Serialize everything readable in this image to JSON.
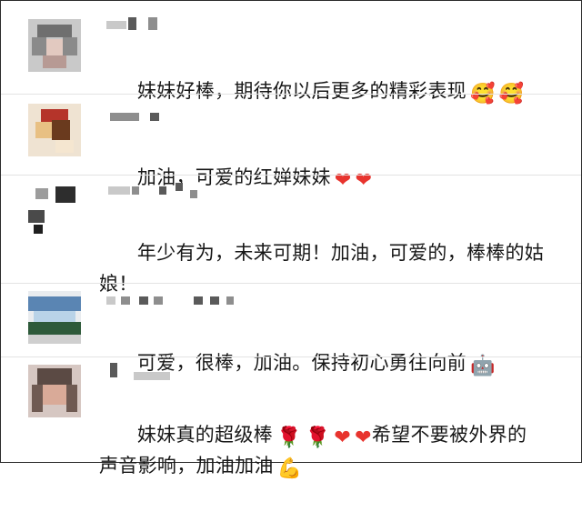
{
  "comments": [
    {
      "name": "",
      "text": "妹妹好棒，期待你以后更多的精彩表现",
      "emojis": [
        "🥰",
        "🥰"
      ],
      "emoji_icons": [
        "blush-face-icon",
        "blush-face-icon"
      ]
    },
    {
      "name": "",
      "text": "加油，可爱的红婵妹妹",
      "emojis": [
        "❤",
        "❤"
      ],
      "emoji_icons": [
        "red-heart-icon",
        "red-heart-icon"
      ]
    },
    {
      "name": "",
      "text": "年少有为，未来可期！加油，可爱的，棒棒的姑\n娘！",
      "emojis": [],
      "emoji_icons": []
    },
    {
      "name": "",
      "text": "可爱，很棒，加油。保持初心勇往向前",
      "emojis": [
        "🤖"
      ],
      "emoji_icons": [
        "robot-face-icon"
      ]
    },
    {
      "name": "",
      "text_1": "妹妹真的超级棒",
      "emojis_1": [
        "🌹",
        "🌹",
        "❤",
        "❤"
      ],
      "emoji_icons_1": [
        "rose-icon",
        "rose-icon",
        "red-heart-icon",
        "red-heart-icon"
      ],
      "text_2": "希望不要被外界的\n声音影响，加油加油",
      "emojis_2": [
        "💪"
      ],
      "emoji_icons_2": [
        "flexed-biceps-icon"
      ]
    }
  ],
  "colors": {
    "text": "#171717",
    "heart": "#e8342e",
    "divider": "#e3e3e3",
    "background": "#ffffff"
  }
}
